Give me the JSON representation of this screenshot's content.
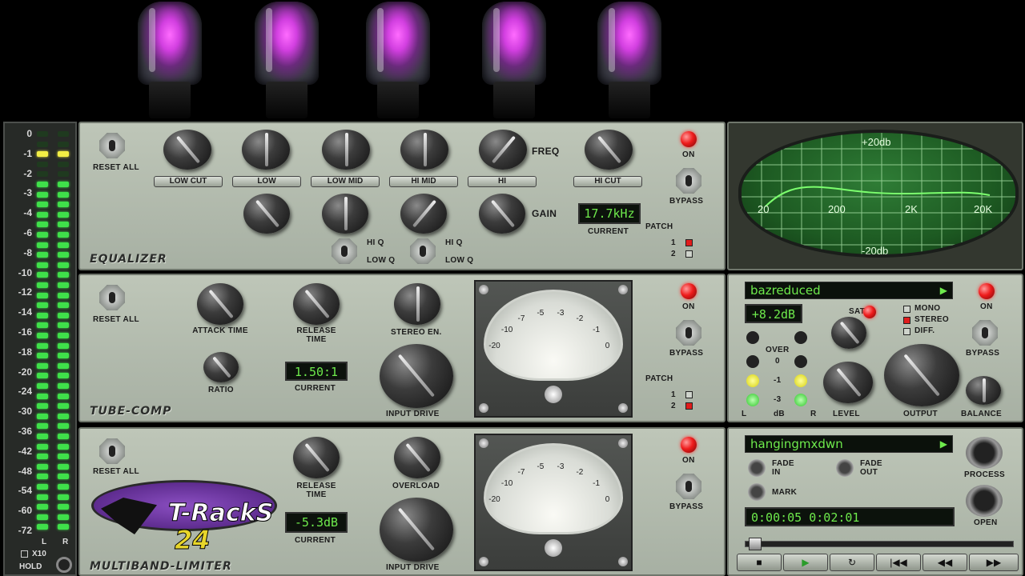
{
  "meter": {
    "scale": [
      "0",
      "-1",
      "-2",
      "-3",
      "-4",
      "-6",
      "-8",
      "-10",
      "-12",
      "-14",
      "-16",
      "-18",
      "-20",
      "-24",
      "-30",
      "-36",
      "-42",
      "-48",
      "-54",
      "-60",
      "-72"
    ],
    "channels": [
      "L",
      "R"
    ],
    "x10_label": "X10",
    "hold_label": "HOLD"
  },
  "equalizer": {
    "title": "EQUALIZER",
    "reset_label": "RESET ALL",
    "bands": [
      "LOW CUT",
      "LOW",
      "LOW MID",
      "HI MID",
      "HI",
      "HI CUT"
    ],
    "freq_label": "FREQ",
    "gain_label": "GAIN",
    "hiq_label": "HI Q",
    "lowq_label": "LOW Q",
    "current_value": "17.7kHz",
    "current_label": "CURRENT",
    "on_label": "ON",
    "bypass_label": "BYPASS",
    "patch_label": "PATCH",
    "patch1": "1",
    "patch2": "2"
  },
  "scope": {
    "top": "+20db",
    "bottom": "-20db",
    "freqs": [
      "20",
      "200",
      "2K",
      "20K"
    ]
  },
  "tubecomp": {
    "title": "TUBE-COMP",
    "reset_label": "RESET ALL",
    "attack_label": "ATTACK TIME",
    "release_label": "RELEASE TIME",
    "stereo_label": "STEREO EN.",
    "ratio_label": "RATIO",
    "ratio_value": "1.50:1",
    "current_label": "CURRENT",
    "input_drive_label": "INPUT DRIVE",
    "on_label": "ON",
    "bypass_label": "BYPASS",
    "patch_label": "PATCH",
    "patch1": "1",
    "patch2": "2",
    "vu_scale": [
      "-20",
      "-10",
      "-7",
      "-5",
      "-3",
      "-2",
      "-1",
      "0"
    ]
  },
  "clipper": {
    "preset": "bazreduced",
    "gain_value": "+8.2dB",
    "sat_label": "SAT",
    "mono_label": "MONO",
    "stereo_label": "STEREO",
    "diff_label": "DIFF.",
    "over_label": "OVER",
    "led_labels": [
      "0",
      "-1",
      "-3"
    ],
    "db_label": "dB",
    "l_label": "L",
    "r_label": "R",
    "level_label": "LEVEL",
    "output_label": "OUTPUT",
    "balance_label": "BALANCE",
    "on_label": "ON",
    "bypass_label": "BYPASS"
  },
  "limiter": {
    "title": "MULTIBAND-LIMITER",
    "reset_label": "RESET ALL",
    "release_label": "RELEASE TIME",
    "overload_label": "OVERLOAD",
    "value": "-5.3dB",
    "current_label": "CURRENT",
    "input_drive_label": "INPUT DRIVE",
    "on_label": "ON",
    "bypass_label": "BYPASS",
    "logo_text": "T-RackS",
    "logo_num": "24"
  },
  "player": {
    "file": "hangingmxdwn",
    "fade_in_label": "FADE IN",
    "fade_out_label": "FADE OUT",
    "mark_label": "MARK",
    "process_label": "PROCESS",
    "open_label": "OPEN",
    "time": "0:00:05  0:02:01",
    "transport": [
      "■",
      "▶",
      "↻",
      "|◀◀",
      "◀◀",
      "▶▶"
    ]
  }
}
